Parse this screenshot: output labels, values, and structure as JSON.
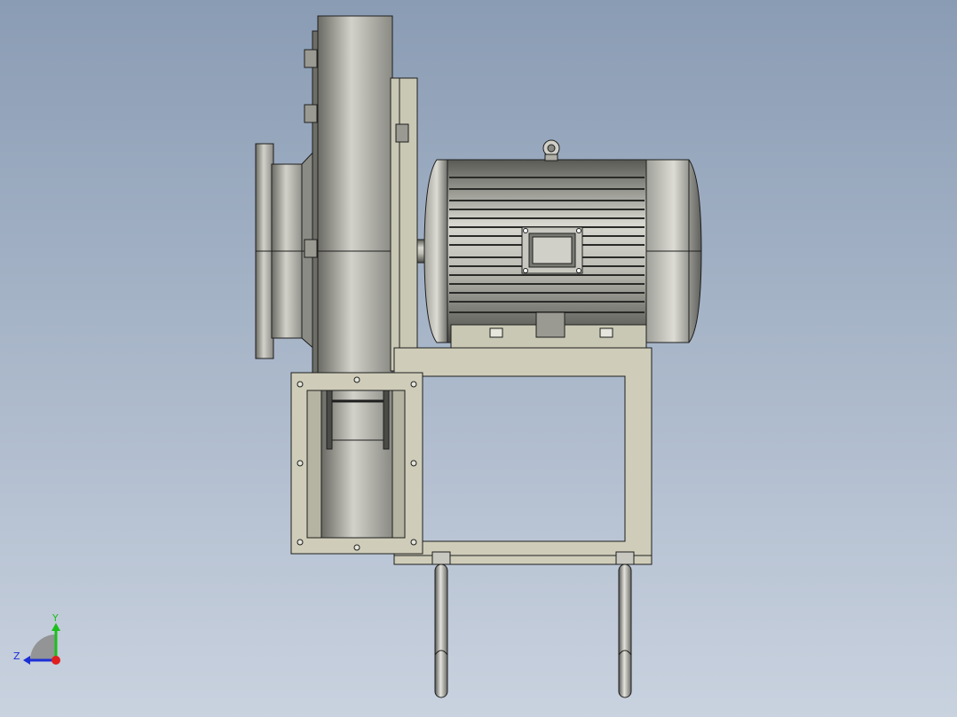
{
  "viewport": {
    "background_top": "#8a9cb4",
    "background_bottom": "#c9d2df"
  },
  "triad": {
    "y_label": "Y",
    "z_label": "Z",
    "x_color": "#e01e1e",
    "y_color": "#1bbf1b",
    "z_color": "#1b2fd6"
  },
  "model": {
    "metal_light": "#d4d4cc",
    "metal_mid": "#a9a9a1",
    "metal_dark": "#4a4a46",
    "frame_fill": "#cfcdb9",
    "edge": "#1e1e1e"
  }
}
